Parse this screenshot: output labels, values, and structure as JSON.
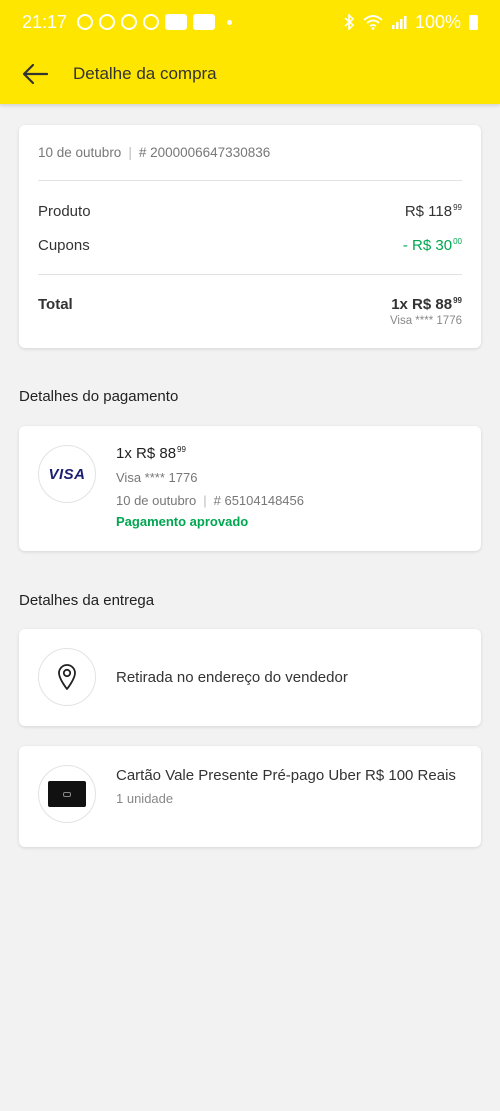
{
  "status_bar": {
    "time": "21:17",
    "battery": "100%"
  },
  "app_bar": {
    "title": "Detalhe da compra"
  },
  "summary": {
    "date": "10 de outubro",
    "order_number": "# 2000006647330836",
    "rows": [
      {
        "label": "Produto",
        "value": "R$ 118",
        "cents": "99"
      },
      {
        "label": "Cupons",
        "value": "- R$ 30",
        "cents": "00"
      }
    ],
    "total_label": "Total",
    "total_value": "1x R$ 88",
    "total_cents": "99",
    "total_card": "Visa **** 1776"
  },
  "payment": {
    "section_title": "Detalhes do pagamento",
    "brand": "VISA",
    "amount": "1x R$ 88",
    "amount_cents": "99",
    "card": "Visa **** 1776",
    "date": "10 de outubro",
    "transaction": "# 65104148456",
    "status": "Pagamento aprovado"
  },
  "delivery": {
    "section_title": "Detalhes da entrega",
    "pickup_text": "Retirada no endereço do vendedor",
    "product_title": "Cartão Vale Presente Pré-pago Uber R$ 100 Reais",
    "product_qty": "1 unidade"
  },
  "icons": {
    "back": "arrow-left-icon",
    "card_brand": "visa-logo",
    "location": "location-pin-icon",
    "product": "gift-card-image"
  },
  "colors": {
    "accent": "#ffe600",
    "success": "#00a650",
    "visa": "#1a1f71"
  }
}
